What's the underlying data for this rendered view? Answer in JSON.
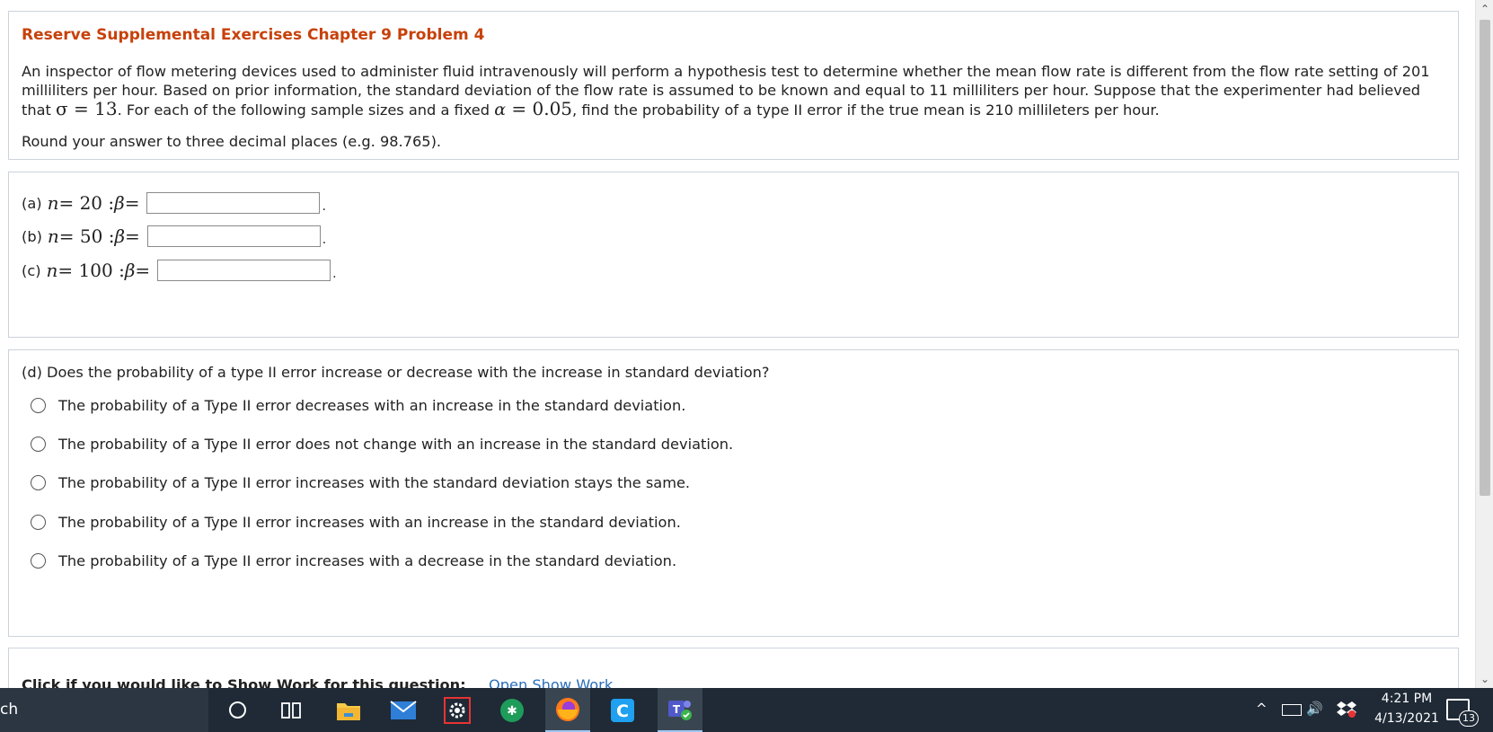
{
  "question": {
    "title": "Reserve Supplemental Exercises Chapter 9 Problem 4",
    "stem_part1": "An inspector of flow metering devices used to administer fluid intravenously will perform a hypothesis test to determine whether the mean flow rate is different from the flow rate setting of 201 milliliters per hour. Based on prior information, the standard deviation of the flow rate is assumed to be known and equal to 11 milliliters per hour. Suppose that the experimenter had believed that ",
    "sigma_symbol": "σ",
    "sigma_value": " = 13",
    "stem_part2": ". For each of the following sample sizes and a fixed ",
    "alpha_symbol": "α",
    "alpha_value": " = 0.05",
    "stem_part3": ", find the probability of a type II error if the true mean is 210 millileters per hour.",
    "round_note": "Round your answer to three decimal places (e.g. 98.765)."
  },
  "parts": [
    {
      "label": "(a)",
      "n_value": " = 20 : ",
      "beta_eq": " =",
      "answer": ""
    },
    {
      "label": "(b)",
      "n_value": " = 50 : ",
      "beta_eq": " =",
      "answer": ""
    },
    {
      "label": "(c)",
      "n_value": " = 100 : ",
      "beta_eq": " =",
      "answer": ""
    }
  ],
  "symbols": {
    "n": "n",
    "beta": "β",
    "period": "."
  },
  "part_d": {
    "question": "(d) Does the probability of a type II error increase or decrease with the increase in standard deviation?",
    "options": [
      "The probability of a Type II error decreases with an increase in the standard deviation.",
      "The probability of a Type II error does not change with an increase in the standard deviation.",
      "The probability of a Type II error increases with the standard deviation stays the same.",
      "The probability of a Type II error increases with an increase in the standard deviation.",
      "The probability of a Type II error increases with a decrease in the standard deviation."
    ]
  },
  "show_work": {
    "label": "Click if you would like to Show Work for this question:",
    "link": "Open Show Work"
  },
  "taskbar": {
    "search_text": "ch",
    "time": "4:21 PM",
    "date": "4/13/2021",
    "notification_count": "13",
    "tray_up_glyph": "^",
    "volume_glyph": "🔊"
  },
  "colors": {
    "title": "#c7410b",
    "link": "#2a6ebb",
    "taskbar": "#1f2a36"
  }
}
